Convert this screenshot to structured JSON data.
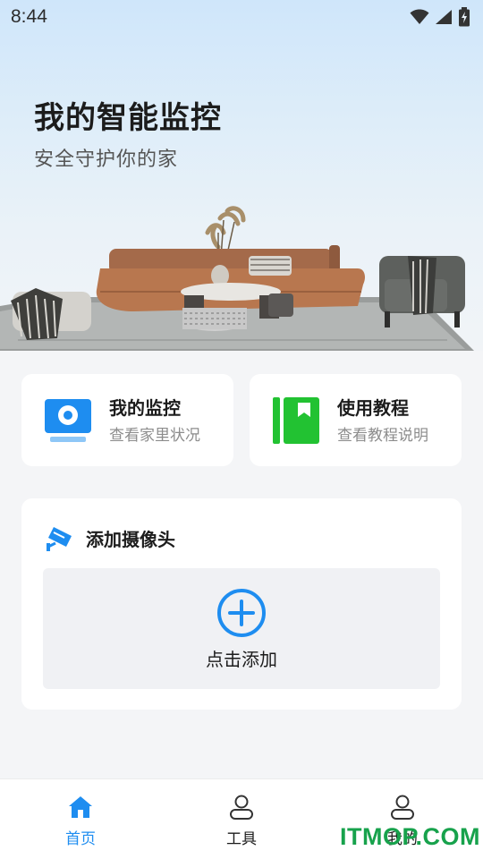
{
  "status_bar": {
    "time": "8:44",
    "icons": [
      "wifi-icon",
      "signal-icon",
      "battery-charging-icon"
    ]
  },
  "hero": {
    "title": "我的智能监控",
    "subtitle": "安全守护你的家",
    "image": "living-room-sofa-illustration"
  },
  "features": [
    {
      "title": "我的监控",
      "subtitle": "查看家里状况",
      "icon": "monitor-camera-icon",
      "color": "#1e8df0"
    },
    {
      "title": "使用教程",
      "subtitle": "查看教程说明",
      "icon": "tutorial-book-icon",
      "color": "#22c232"
    }
  ],
  "add_camera": {
    "title": "添加摄像头",
    "icon": "security-camera-icon",
    "action_label": "点击添加",
    "action_icon": "plus-circle-icon"
  },
  "bottom_nav": {
    "items": [
      {
        "label": "首页",
        "icon": "home-icon",
        "active": true
      },
      {
        "label": "工具",
        "icon": "user-icon",
        "active": false
      },
      {
        "label": "我的",
        "icon": "user-icon",
        "active": false
      }
    ]
  },
  "watermark": "ITMOP.COM",
  "colors": {
    "accent": "#1e8df0",
    "green": "#22c232",
    "background": "#f4f5f7",
    "watermark": "#17a24c"
  }
}
